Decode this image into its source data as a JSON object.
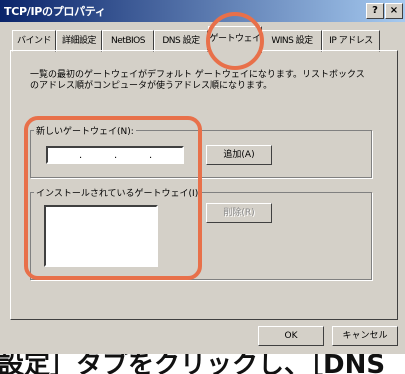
{
  "window": {
    "title": "TCP/IPのプロパティ",
    "help_label": "?",
    "close_label": "×"
  },
  "tabs": [
    {
      "label": "バインド"
    },
    {
      "label": "詳細設定"
    },
    {
      "label": "NetBIOS"
    },
    {
      "label": "DNS 設定"
    },
    {
      "label": "ゲートウェイ",
      "active": true
    },
    {
      "label": "WINS 設定"
    },
    {
      "label": "IP アドレス"
    }
  ],
  "description": {
    "line1": "一覧の最初のゲートウェイがデフォルト ゲートウェイになります。リストボックス",
    "line2": "のアドレス順がコンピュータが使うアドレス順になります。"
  },
  "new_gateway": {
    "label": "新しいゲートウェイ(N):",
    "ip_separator": ".",
    "add_button": "追加(A)"
  },
  "installed_gateways": {
    "label": "インストールされているゲートウェイ(I)",
    "remove_button": "削除(R)"
  },
  "buttons": {
    "ok": "OK",
    "cancel": "キャンセル"
  },
  "caption": "設定］タブをクリックし、［DNS",
  "colors": {
    "highlight": "#e8704a",
    "dialog_face": "#d4d0c8",
    "titlebar": "#0a246a"
  }
}
